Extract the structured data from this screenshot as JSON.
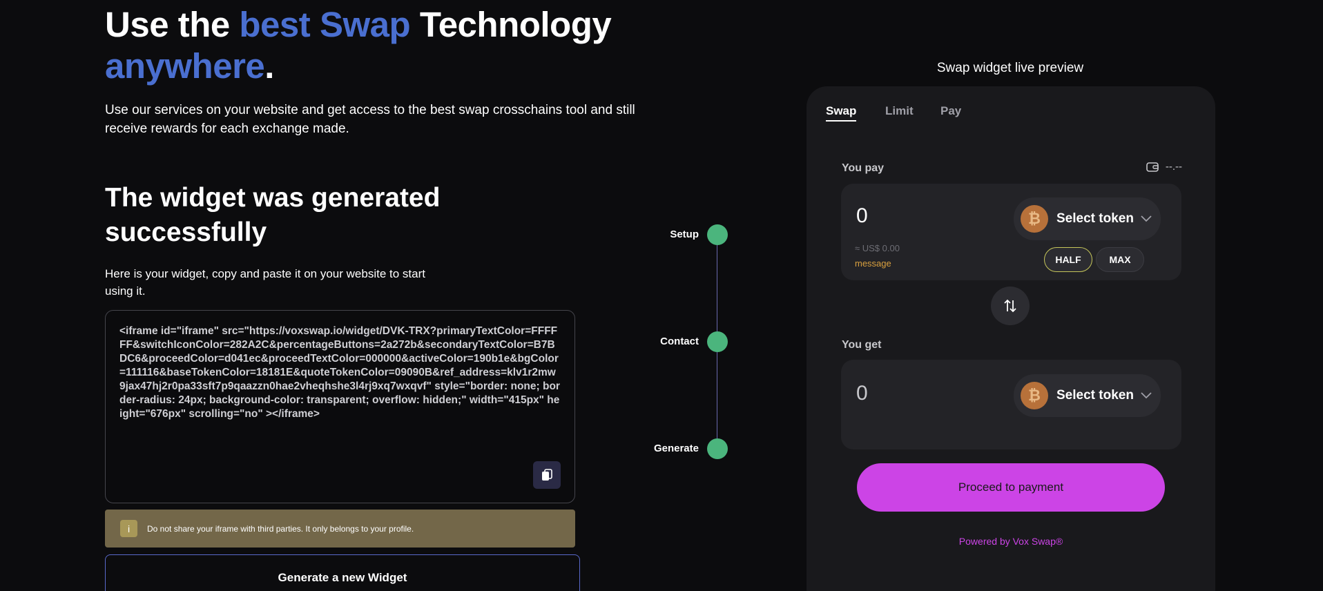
{
  "hero": {
    "title_1": "Use the ",
    "title_accent_1": "best Swap",
    "title_2": " Technology",
    "title_accent_2": "anywhere",
    "title_end": ".",
    "subtitle": "Use our services on your website and get access to the best swap crosschains tool and still receive rewards for each exchange made."
  },
  "generated": {
    "title": "The widget was generated successfully",
    "subtitle": "Here is your widget, copy and paste it on your website to start using it.",
    "code": "<iframe id=\"iframe\" src=\"https://voxswap.io/widget/DVK-TRX?primaryTextColor=FFFFFF&switchIconColor=282A2C&percentageButtons=2a272b&secondaryTextColor=B7BDC6&proceedColor=d041ec&proceedTextColor=000000&activeColor=190b1e&bgColor=111116&baseTokenColor=18181E&quoteTokenColor=09090B&ref_address=klv1r2mw9jax47hj2r0pa33sft7p9qaazzn0hae2vheqhshe3l4rj9xq7wxqvf\" style=\"border: none; border-radius: 24px; background-color: transparent; overflow: hidden;\" width=\"415px\" height=\"676px\" scrolling=\"no\" ></iframe>",
    "copy_icon": "copy-icon",
    "warning_icon": "i",
    "warning": "Do not share your iframe with third parties. It only belongs to your profile.",
    "new_widget_label": "Generate a new Widget"
  },
  "steps": [
    {
      "label": "Setup"
    },
    {
      "label": "Contact"
    },
    {
      "label": "Generate"
    }
  ],
  "preview": {
    "title": "Swap widget live preview",
    "tabs": [
      "Swap",
      "Limit",
      "Pay"
    ],
    "active_tab": "Swap",
    "pay_label": "You pay",
    "balance": "--.--",
    "pay_amount": "0",
    "select_token": "Select token",
    "btc_glyph": "₿",
    "usd_estimate": "≈ US$ 0.00",
    "message": "message",
    "half_label": "HALF",
    "max_label": "MAX",
    "get_label": "You get",
    "get_amount": "0",
    "proceed_label": "Proceed to payment",
    "powered_by": "Powered by Vox Swap®"
  },
  "colors": {
    "accent": "#4a6fd0",
    "step_done": "#4bb57d",
    "proceed": "#cc44e6",
    "warning_bg": "#736749",
    "message": "#d9a03f"
  }
}
